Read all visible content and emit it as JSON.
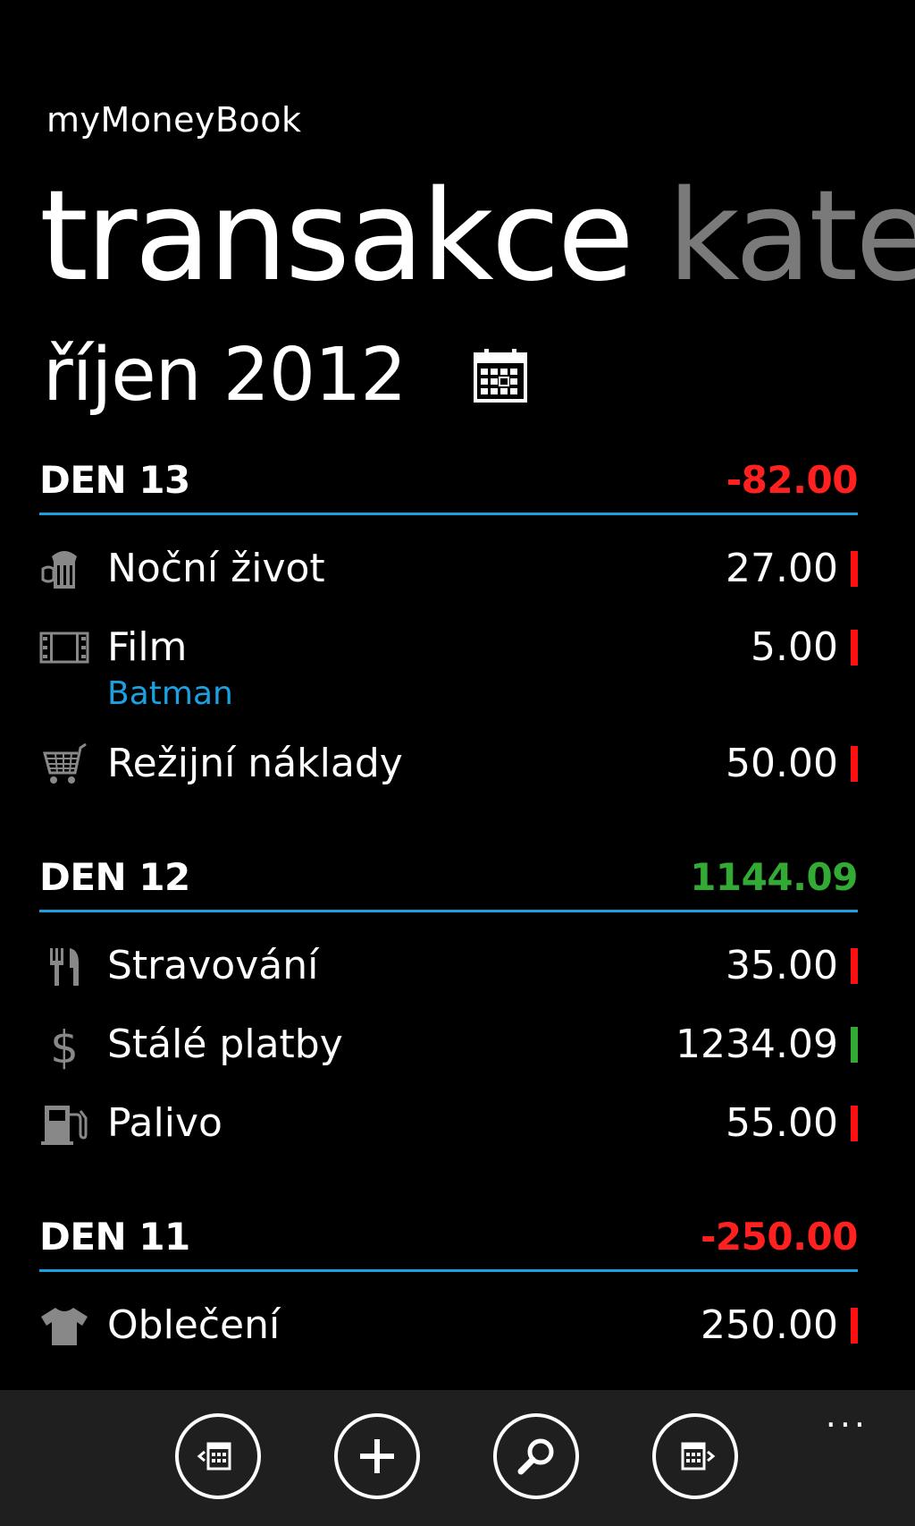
{
  "app": {
    "title": "myMoneyBook"
  },
  "pivot": {
    "active": "transakce",
    "next": "kateg"
  },
  "month": {
    "label": "říjen 2012",
    "icon": "calendar-icon"
  },
  "groups": [
    {
      "day": "DEN 13",
      "total": "-82.00",
      "total_sign": "negative",
      "items": [
        {
          "name": "Noční život",
          "amount": "27.00",
          "icon": "nightlife-icon",
          "type": "expense"
        },
        {
          "name": "Film",
          "note": "Batman",
          "amount": "5.00",
          "icon": "film-icon",
          "type": "expense"
        },
        {
          "name": "Režijní náklady",
          "amount": "50.00",
          "icon": "cart-icon",
          "type": "expense"
        }
      ]
    },
    {
      "day": "DEN 12",
      "total": "1144.09",
      "total_sign": "positive",
      "items": [
        {
          "name": "Stravování",
          "amount": "35.00",
          "icon": "fork-knife-icon",
          "type": "expense"
        },
        {
          "name": "Stálé platby",
          "amount": "1234.09",
          "icon": "dollar-icon",
          "type": "income"
        },
        {
          "name": "Palivo",
          "amount": "55.00",
          "icon": "fuel-icon",
          "type": "expense"
        }
      ]
    },
    {
      "day": "DEN 11",
      "total": "-250.00",
      "total_sign": "negative",
      "items": [
        {
          "name": "Oblečení",
          "amount": "250.00",
          "icon": "tshirt-icon",
          "type": "expense"
        }
      ]
    }
  ],
  "appbar": {
    "buttons": [
      "previous-month-icon",
      "add-icon",
      "search-icon",
      "next-month-icon"
    ],
    "more": "..."
  },
  "colors": {
    "accent": "#1ba1e2",
    "negative": "#ff2020",
    "positive": "#33aa33",
    "appbar_bg": "#1f1f1f"
  }
}
